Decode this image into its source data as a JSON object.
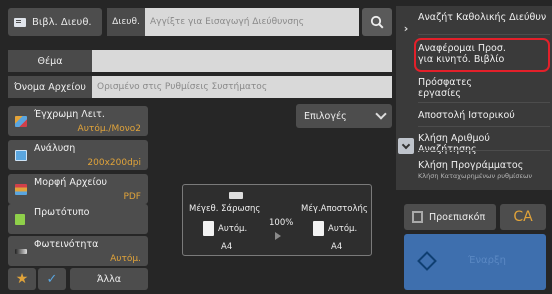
{
  "top": {
    "address_book_label": "Βιβλ. Διευθ.",
    "to_label": "Διευθ.",
    "address_placeholder": "Αγγίξτε για Εισαγωγή Διεύθυνσης"
  },
  "fields": {
    "subject_label": "Θέμα",
    "subject_value": "",
    "filename_label": "Όνομα Αρχείου",
    "filename_placeholder": "Ορισμένο στις Ρυθμίσεις Συστήματος"
  },
  "settings": [
    {
      "name": "Έγχρωμη Λειτ.",
      "value": "Αυτόμ./Μονο2"
    },
    {
      "name": "Ανάλυση",
      "value": "200x200dpi"
    },
    {
      "name": "Μορφή Αρχείου",
      "value": "PDF"
    },
    {
      "name": "Πρωτότυπο",
      "value": ""
    },
    {
      "name": "Φωτεινότητα",
      "value": "Αυτόμ."
    }
  ],
  "options_label": "Επιλογές",
  "preview": {
    "scan_size_label": "Μέγεθ. Σάρωσης",
    "scan_size_mode": "Αυτόμ.",
    "scan_size_paper": "A4",
    "ratio": "100%",
    "send_size_label": "Μέγ.Αποστολής",
    "send_size_mode": "Αυτόμ.",
    "send_size_paper": "A4"
  },
  "bottom": {
    "other_label": "Άλλα"
  },
  "right_panel": {
    "items": [
      {
        "label": "Αναζήτ Καθολικής Διεύθυν"
      },
      {
        "label_line1": "Αναφέρομαι Προσ.",
        "label_line2": "για κινητό. Βιβλίο"
      },
      {
        "label_line1": "Πρόσφατες",
        "label_line2": "εργασίες"
      },
      {
        "label": "Αποστολή Ιστορικού"
      },
      {
        "label": "Κλήση Αριθμού Αναζήτησης"
      },
      {
        "label": "Κλήση Προγράμματος",
        "sub": "Κλήση Καταχωρημένων ρυθμίσεων"
      }
    ],
    "preview_label": "Προεπισκόπ",
    "ca_label": "CA",
    "start_label": "Έναρξη"
  },
  "colors": {
    "accent": "#e0a33a",
    "highlight": "#e3202a",
    "start": "#3e6fae"
  }
}
